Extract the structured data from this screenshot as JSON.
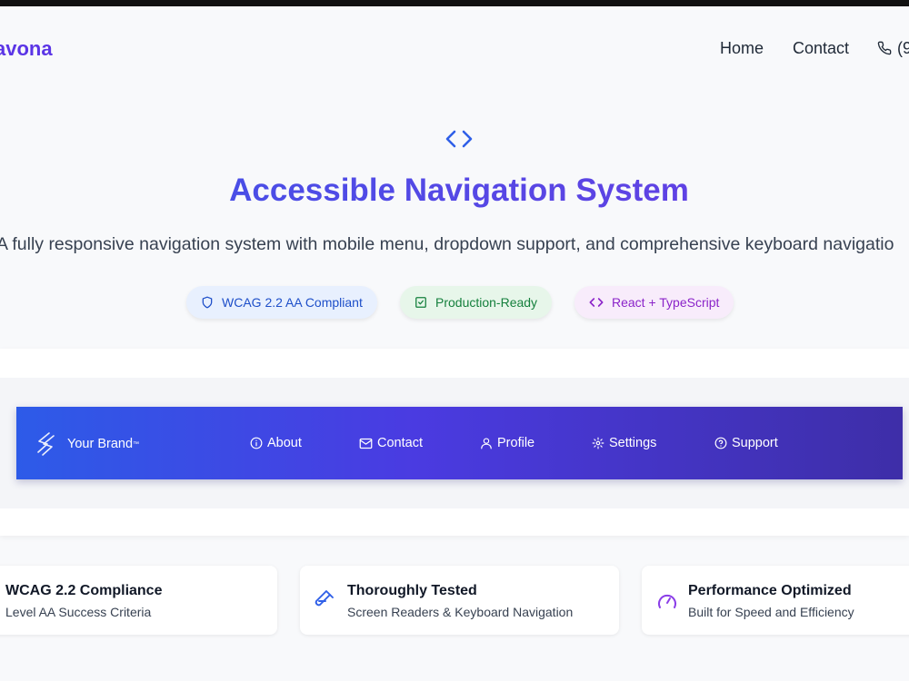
{
  "header": {
    "logo": "avona",
    "nav": [
      {
        "label": "Home"
      },
      {
        "label": "Contact"
      }
    ],
    "phone_label": "(9"
  },
  "hero": {
    "icon": "code-icon",
    "title": "Accessible Navigation System",
    "subtitle": "A fully responsive navigation system with mobile menu, dropdown support, and comprehensive keyboard navigatio",
    "badges": [
      {
        "label": "WCAG 2.2 AA Compliant",
        "icon": "shield-icon",
        "bg": "#e8f0fe",
        "color": "#1e4fc9"
      },
      {
        "label": "Production-Ready",
        "icon": "check-square-icon",
        "bg": "#e7f6ea",
        "color": "#15803d"
      },
      {
        "label": "React + TypeScript",
        "icon": "code-icon",
        "bg": "#f8ecfb",
        "color": "#8b24c9"
      }
    ]
  },
  "demo_nav": {
    "brand": "Your Brand",
    "brand_mark": "™",
    "items": [
      {
        "label": "About",
        "icon": "info-icon"
      },
      {
        "label": "Contact",
        "icon": "mail-icon"
      },
      {
        "label": "Profile",
        "icon": "user-icon"
      },
      {
        "label": "Settings",
        "icon": "gear-icon"
      },
      {
        "label": "Support",
        "icon": "help-circle-icon"
      }
    ]
  },
  "features": [
    {
      "title": "WCAG 2.2 Compliance",
      "subtitle": "Level AA Success Criteria",
      "icon": "shield-icon"
    },
    {
      "title": "Thoroughly Tested",
      "subtitle": "Screen Readers & Keyboard Navigation",
      "icon": "test-tube-icon"
    },
    {
      "title": "Performance Optimized",
      "subtitle": "Built for Speed and Efficiency",
      "icon": "gauge-icon"
    }
  ],
  "colors": {
    "brand": "#5b35e6",
    "accent_blue": "#2d5be8",
    "accent_purple": "#4a3be1"
  }
}
